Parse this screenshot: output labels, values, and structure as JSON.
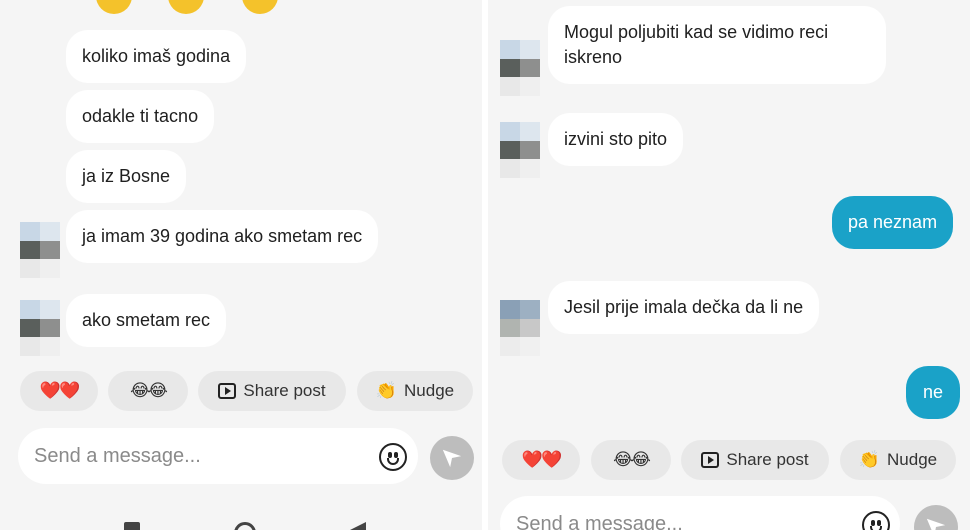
{
  "left": {
    "messages": [
      {
        "text": "koliko imaš godina",
        "direction": "incoming"
      },
      {
        "text": "odakle ti tacno",
        "direction": "incoming"
      },
      {
        "text": "ja iz Bosne",
        "direction": "incoming"
      },
      {
        "text": "ja imam 39 godina ako smetam rec",
        "direction": "incoming"
      },
      {
        "text": "ako smetam rec",
        "direction": "incoming"
      }
    ],
    "quick_replies": {
      "hearts": "❤️❤️",
      "laughs": "😂😂",
      "share_post": "Share post",
      "nudge": "Nudge"
    },
    "input_placeholder": "Send a message..."
  },
  "right": {
    "messages": [
      {
        "text": "Mogul poljubiti kad se vidimo reci iskreno",
        "direction": "incoming"
      },
      {
        "text": "izvini sto pito",
        "direction": "incoming"
      },
      {
        "text": "pa neznam",
        "direction": "outgoing"
      },
      {
        "text": "Jesil prije imala dečka da li ne",
        "direction": "incoming"
      },
      {
        "text": "ne",
        "direction": "outgoing"
      }
    ],
    "quick_replies": {
      "hearts": "❤️❤️",
      "laughs": "😂😂",
      "share_post": "Share post",
      "nudge": "Nudge"
    },
    "input_placeholder": "Send a message..."
  },
  "colors": {
    "outgoing_bubble": "#1aa2c8",
    "incoming_bubble": "#ffffff",
    "chat_background": "#f5f5f5",
    "chip_background": "#e8e8e8",
    "send_button": "#bdbdbd"
  },
  "icons": [
    "play-icon",
    "hand-icon",
    "smiley-icon",
    "send-icon",
    "avatar-pixelated"
  ]
}
